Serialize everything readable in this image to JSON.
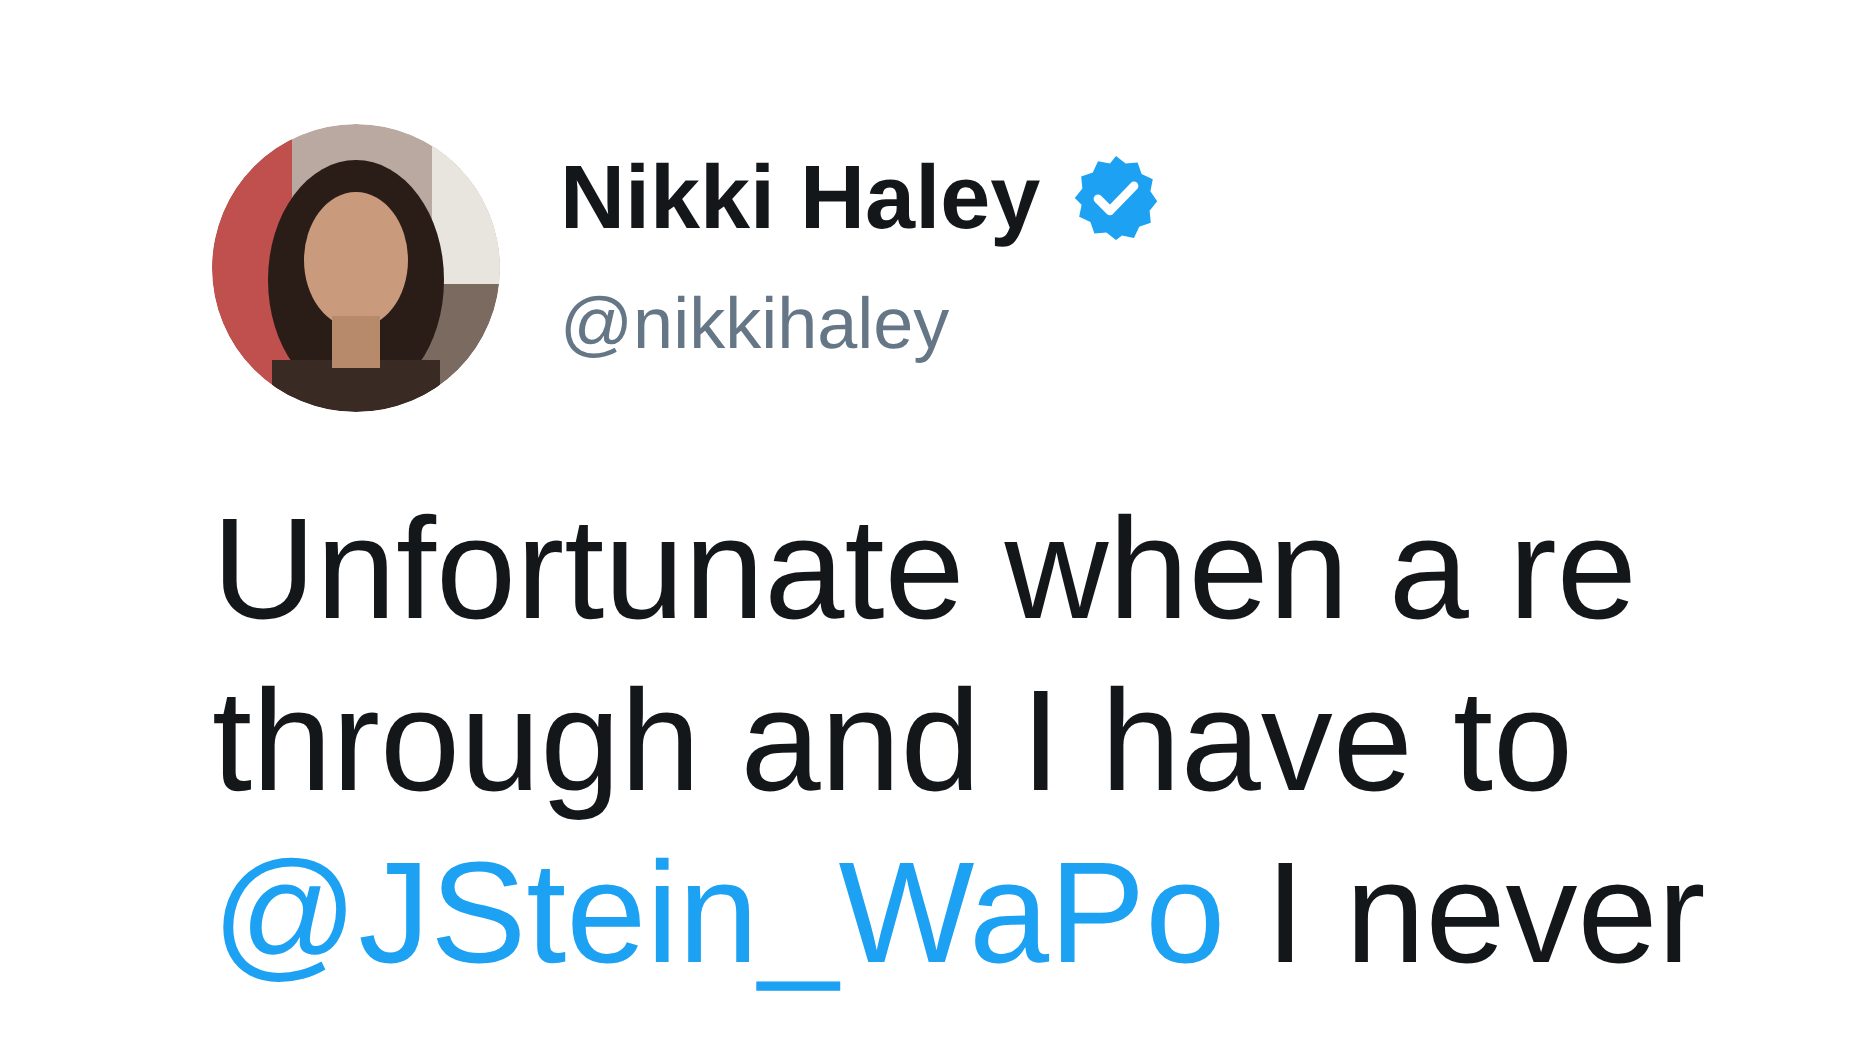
{
  "author": {
    "name": "Nikki Haley",
    "verified": true,
    "handle": "@nikkihaley"
  },
  "tweet": {
    "lines": [
      {
        "parts": [
          {
            "kind": "text",
            "text": "Unfortunate when a re"
          }
        ]
      },
      {
        "parts": [
          {
            "kind": "text",
            "text": "through and I have to"
          }
        ]
      },
      {
        "parts": [
          {
            "kind": "mention",
            "text": "@JStein_WaPo"
          },
          {
            "kind": "text",
            "text": "I never"
          }
        ]
      }
    ]
  }
}
